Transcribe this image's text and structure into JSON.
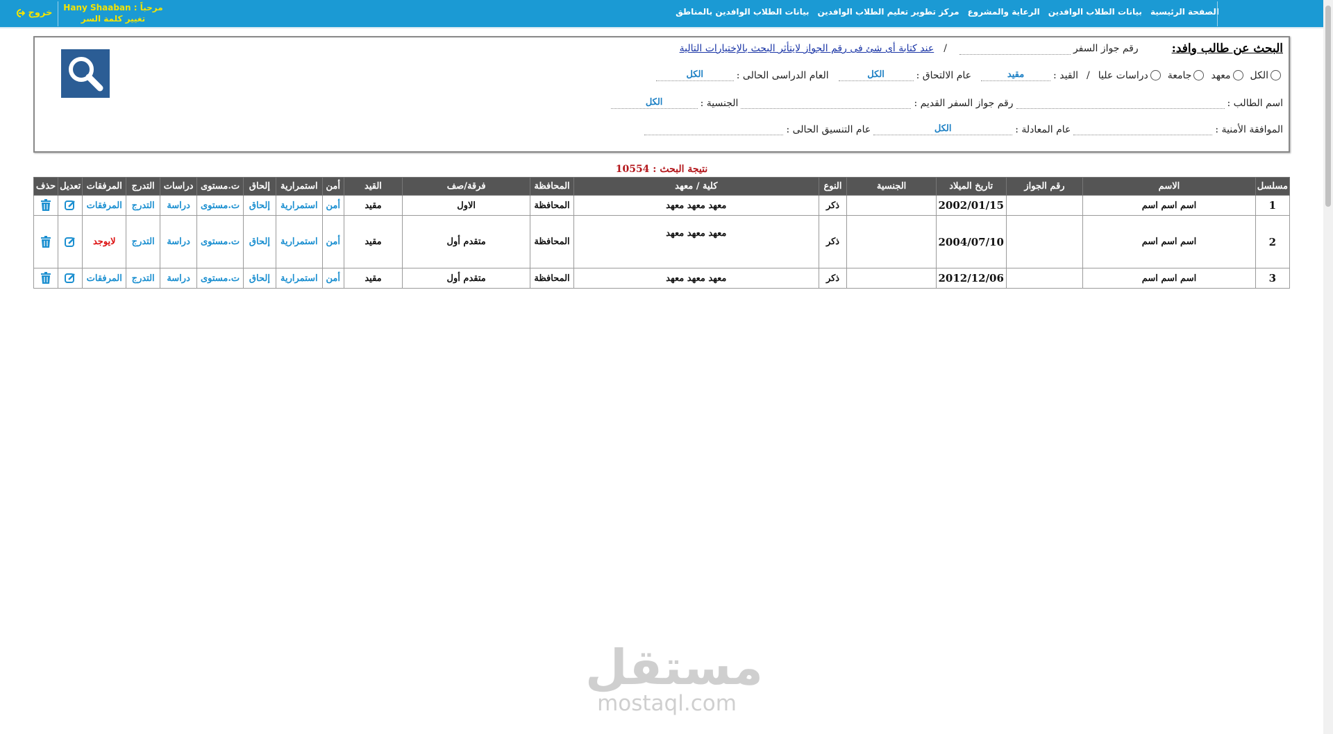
{
  "header": {
    "nav": [
      "الصفحة الرئيسية",
      "بيانات الطلاب الوافدين",
      "الرعاية والمشروع",
      "مركز تطوير تعليم الطلاب الوافدين",
      "بيانات الطلاب الوافدين بالمناطق"
    ],
    "welcome": "مرحباً : Hany Shaaban",
    "change_password": "تغيير كلمة السر",
    "logout": "خروج"
  },
  "search": {
    "title": "البحث عن طالب وافد:",
    "passport_label": "رقم جواز السفر",
    "slash": "/",
    "hint": "عند كتابة أى شئ فى رقم الجواز لايتأثر البحث بالإختيارات التالية",
    "type_options": [
      "الكل",
      "معهد",
      "جامعة",
      "دراسات عليا"
    ],
    "enrollment_label": "القيد :",
    "enrollment_value": "مقيد",
    "join_year_label": "عام الالتحاق :",
    "join_year_value": "الكل",
    "current_year_label": "العام الدراسى الحالى :",
    "current_year_value": "الكل",
    "student_name_label": "اسم الطالب :",
    "old_passport_label": "رقم جواز السفر القديم :",
    "nationality_label": "الجنسية :",
    "nationality_value": "الكل",
    "security_label": "الموافقة الأمنية :",
    "equivalence_label": "عام المعادلة :",
    "equivalence_value": "الكل",
    "coordination_label": "عام التنسيق الحالى :"
  },
  "result_text": "نتيجة البحث : 10554",
  "table": {
    "headers": [
      "مسلسل",
      "الاسم",
      "رقم الجواز",
      "تاريخ الميلاد",
      "الجنسية",
      "النوع",
      "كلية / معهد",
      "المحافظة",
      "فرقة/صف",
      "القيد",
      "أمن",
      "استمرارية",
      "إلحاق",
      "ت.مستوى",
      "دراسات",
      "التدرج",
      "المرفقات",
      "تعديل",
      "حذف"
    ],
    "rows": [
      {
        "serial": "1",
        "name": "اسم اسم اسم",
        "passport": "",
        "dob": "2002/01/15",
        "nationality": "",
        "gender": "ذكر",
        "college": "معهد معهد معهد",
        "governorate": "المحافظة",
        "grade": "الاول",
        "status": "مقيد",
        "security": "أمن",
        "continuity": "استمرارية",
        "enroll": "إلحاق",
        "level": "ت.مستوى",
        "study": "دراسة",
        "grading": "التدرج",
        "attachments": "المرفقات",
        "attach_missing": false
      },
      {
        "serial": "2",
        "name": "اسم اسم اسم",
        "passport": "",
        "dob": "2004/07/10",
        "nationality": "",
        "gender": "ذكر",
        "college": "معهد معهد معهد",
        "governorate": "المحافظة",
        "grade": "متقدم أول",
        "status": "مقيد",
        "security": "أمن",
        "continuity": "استمرارية",
        "enroll": "إلحاق",
        "level": "ت.مستوى",
        "study": "دراسة",
        "grading": "التدرج",
        "attachments": "لايوجد",
        "attach_missing": true
      },
      {
        "serial": "3",
        "name": "اسم اسم اسم",
        "passport": "",
        "dob": "2012/12/06",
        "nationality": "",
        "gender": "ذكر",
        "college": "معهد معهد معهد",
        "governorate": "المحافظة",
        "grade": "متقدم أول",
        "status": "مقيد",
        "security": "أمن",
        "continuity": "استمرارية",
        "enroll": "إلحاق",
        "level": "ت.مستوى",
        "study": "دراسة",
        "grading": "التدرج",
        "attachments": "المرفقات",
        "attach_missing": false
      }
    ]
  },
  "watermark": {
    "arabic": "مستقل",
    "latin": "mostaql.com"
  },
  "icons": {
    "search": "search-icon",
    "edit": "edit-icon",
    "delete": "trash-icon",
    "logout": "logout-icon"
  },
  "colors": {
    "topbar": "#1b9ad4",
    "link": "#1b8fd0",
    "result": "#b3161b",
    "header_bg": "#555555"
  }
}
